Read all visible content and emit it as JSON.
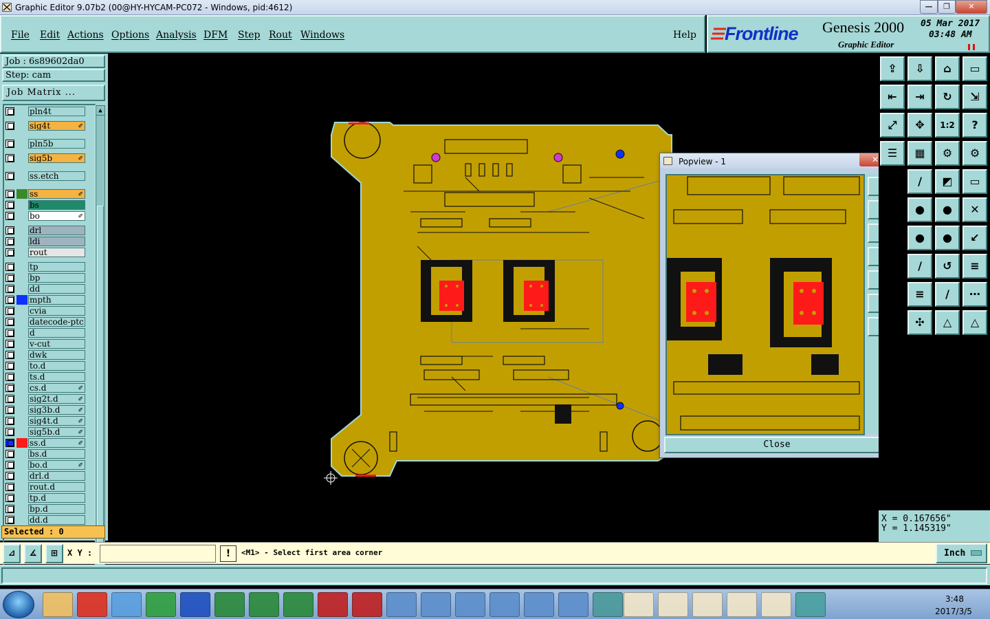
{
  "window": {
    "title": "Graphic Editor 9.07b2 (00@HY-HYCAM-PC072 - Windows, pid:4612)",
    "controls": {
      "minimize": "—",
      "restore": "❐",
      "close": "✕"
    }
  },
  "menu": {
    "items": [
      "File",
      "Edit",
      "Actions",
      "Options",
      "Analysis",
      "DFM",
      "Step",
      "Rout",
      "Windows"
    ],
    "help": "Help"
  },
  "brand": {
    "logo": "Frontline",
    "product": "Genesis 2000",
    "subtitle": "Graphic Editor",
    "date": "05 Mar 2017",
    "time": "03:48 AM"
  },
  "job": {
    "job_label": "Job : 6s89602da0",
    "step_label": "Step: cam",
    "matrix_button": "Job Matrix ..."
  },
  "layers": [
    {
      "name": "pln4t",
      "color": "#a5d8d6",
      "editable": false
    },
    {
      "name": "sig4t",
      "color": "#f5b342",
      "editable": true
    },
    {
      "name": "pln5b",
      "color": "#a5d8d6",
      "editable": false
    },
    {
      "name": "sig5b",
      "color": "#f5b342",
      "editable": true
    },
    {
      "name": "ss.etch",
      "color": "#a5d8d6",
      "editable": false
    },
    {
      "name": "ss",
      "color": "#f5b342",
      "swatch": "#3a8a2a",
      "editable": true
    },
    {
      "name": "bs",
      "color": "#1f8a6a",
      "editable": false
    },
    {
      "name": "bo",
      "color": "#ffffff",
      "editable": true
    },
    {
      "name": "drl",
      "color": "#9fb3bf",
      "editable": false
    },
    {
      "name": "ldi",
      "color": "#9fb3bf",
      "editable": false
    },
    {
      "name": "rout",
      "color": "#e6e6e6",
      "editable": false
    },
    {
      "name": "tp",
      "color": "#a5d8d6",
      "editable": false
    },
    {
      "name": "bp",
      "color": "#a5d8d6",
      "editable": false
    },
    {
      "name": "dd",
      "color": "#a5d8d6",
      "editable": false
    },
    {
      "name": "mpth",
      "color": "#a5d8d6",
      "swatch": "#1030ff",
      "editable": false
    },
    {
      "name": "cvia",
      "color": "#a5d8d6",
      "editable": false
    },
    {
      "name": "datecode-ptc",
      "color": "#a5d8d6",
      "editable": false
    },
    {
      "name": "d",
      "color": "#a5d8d6",
      "editable": false
    },
    {
      "name": "v-cut",
      "color": "#a5d8d6",
      "editable": false
    },
    {
      "name": "dwk",
      "color": "#a5d8d6",
      "editable": false
    },
    {
      "name": "to.d",
      "color": "#a5d8d6",
      "editable": false
    },
    {
      "name": "ts.d",
      "color": "#a5d8d6",
      "editable": false
    },
    {
      "name": "cs.d",
      "color": "#a5d8d6",
      "editable": true
    },
    {
      "name": "sig2t.d",
      "color": "#a5d8d6",
      "editable": true
    },
    {
      "name": "sig3b.d",
      "color": "#a5d8d6",
      "editable": true
    },
    {
      "name": "sig4t.d",
      "color": "#a5d8d6",
      "editable": true
    },
    {
      "name": "sig5b.d",
      "color": "#a5d8d6",
      "editable": true
    },
    {
      "name": "ss.d",
      "color": "#a5d8d6",
      "swatch": "#ff1a1a",
      "editable": true,
      "active": true
    },
    {
      "name": "bs.d",
      "color": "#a5d8d6",
      "editable": false
    },
    {
      "name": "bo.d",
      "color": "#a5d8d6",
      "editable": true
    },
    {
      "name": "drl.d",
      "color": "#a5d8d6",
      "editable": false
    },
    {
      "name": "rout.d",
      "color": "#a5d8d6",
      "editable": false
    },
    {
      "name": "tp.d",
      "color": "#a5d8d6",
      "editable": false
    },
    {
      "name": "bp.d",
      "color": "#a5d8d6",
      "editable": false
    },
    {
      "name": "dd.d",
      "color": "#a5d8d6",
      "editable": false
    }
  ],
  "selected": "Selected : 0",
  "command": {
    "xy_label": "X Y :",
    "xy_value": "",
    "prompt": "<M1> - Select first area corner",
    "units": "Inch"
  },
  "coords": {
    "x": "X = 0.167656\"",
    "y": "Y = 1.145319\""
  },
  "popview": {
    "title": "Popview - 1",
    "close": "Close"
  },
  "toolbar_icons": [
    "zoom-home-icon",
    "zoom-back-icon",
    "snap-icon",
    "window-icon",
    "pan-left-icon",
    "pan-right-icon",
    "redraw-icon",
    "zoom-fit-icon",
    "fit-all-icon",
    "center-icon",
    "scale-one-icon",
    "help-icon"
  ],
  "tray": {
    "time": "3:48",
    "date": "2017/3/5"
  },
  "colors": {
    "panel": "#a5d8d6",
    "board": "#c8a000",
    "copper_pad": "#ff1a1a"
  }
}
